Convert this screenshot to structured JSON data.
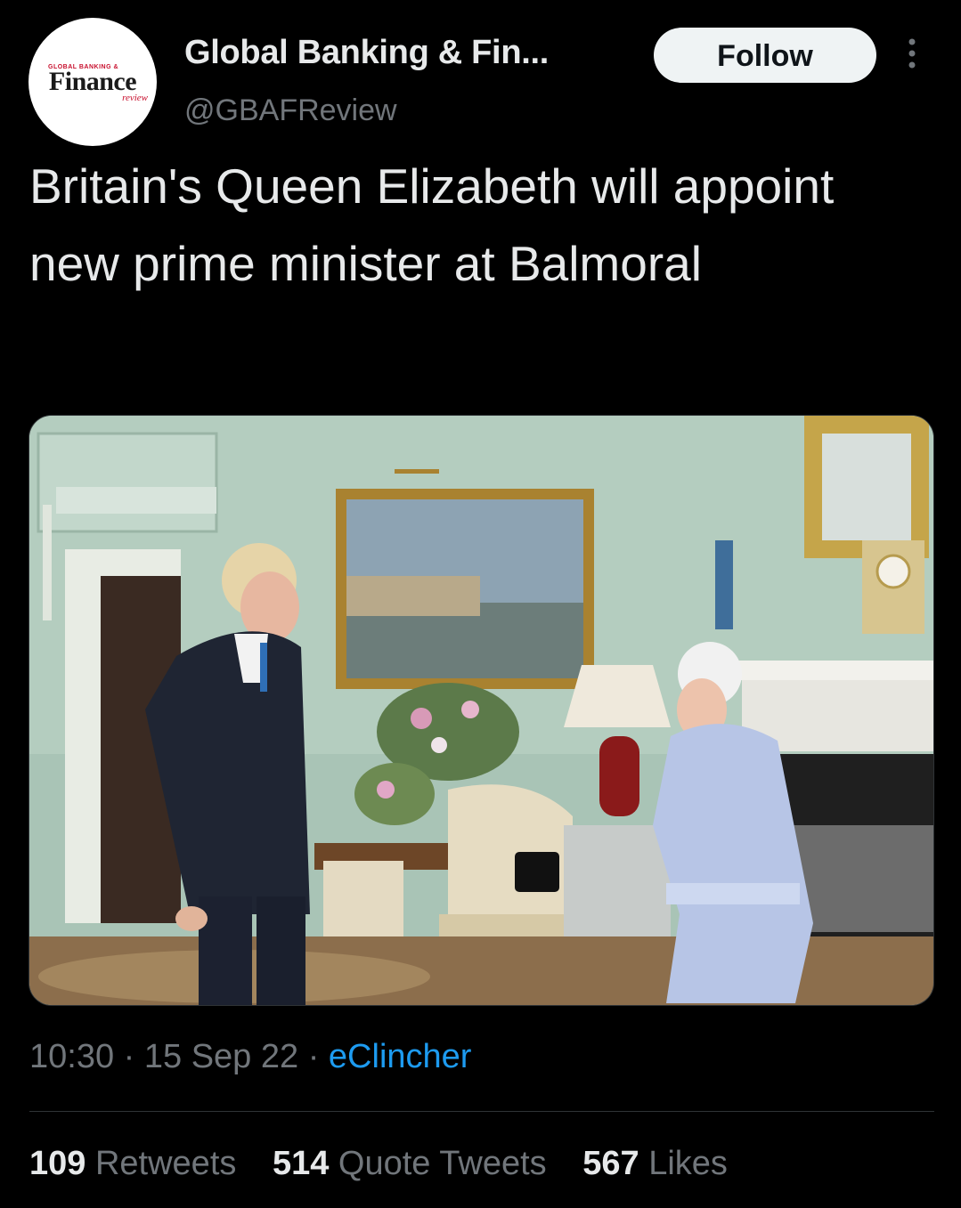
{
  "account": {
    "avatar_logo_top": "GLOBAL BANKING &",
    "avatar_logo_main": "Finance",
    "avatar_logo_sub": "review",
    "display_name": "Global Banking & Fin...",
    "handle": "@GBAFReview"
  },
  "follow_label": "Follow",
  "more_icon": "more-vertical-icon",
  "tweet": {
    "text": "Britain's Queen Elizabeth will appoint new prime minister at Balmoral",
    "time": "10:30",
    "date": "15 Sep 22",
    "source": "eClincher",
    "separator": " · "
  },
  "stats": {
    "retweets": "109",
    "retweets_label": "Retweets",
    "quotes": "514",
    "quotes_label": "Quote Tweets",
    "likes": "567",
    "likes_label": "Likes"
  },
  "colors": {
    "background": "#000000",
    "text": "#e7e9ea",
    "muted": "#71767b",
    "link": "#1d9bf0",
    "follow_bg": "#eff3f4"
  }
}
